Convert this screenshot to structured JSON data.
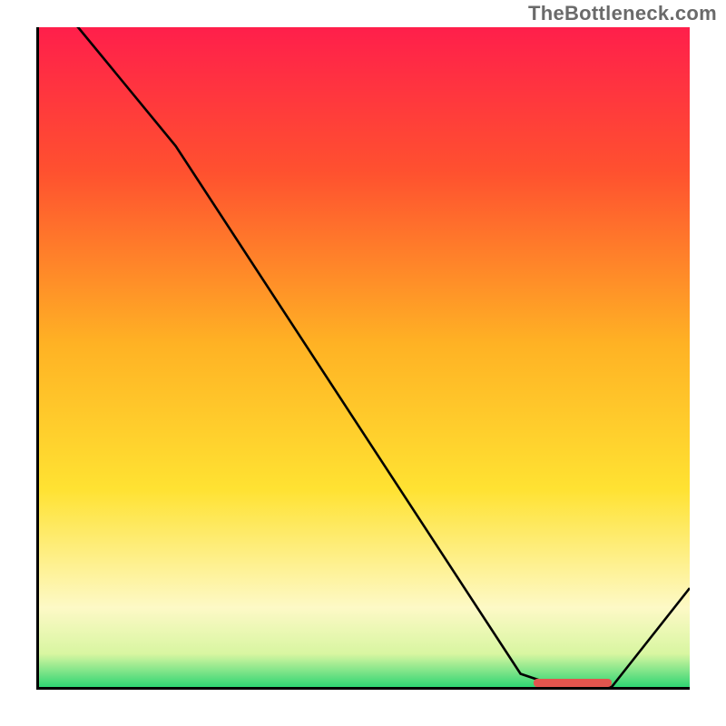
{
  "attribution": "TheBottleneck.com",
  "colors": {
    "gradient_top": "#ff1f4b",
    "gradient_upper_mid": "#ff6a2a",
    "gradient_mid": "#ffb224",
    "gradient_lower_mid": "#ffe232",
    "gradient_pale": "#fdf9c6",
    "gradient_bottom": "#2fd573",
    "curve": "#000000",
    "marker": "#e2554e",
    "axis": "#000000"
  },
  "chart_data": {
    "type": "line",
    "title": "",
    "xlabel": "",
    "ylabel": "",
    "xlim": [
      0,
      100
    ],
    "ylim": [
      0,
      100
    ],
    "gradient_stops": [
      {
        "offset": 0.0,
        "color": "#ff1f4b"
      },
      {
        "offset": 0.22,
        "color": "#ff512f"
      },
      {
        "offset": 0.48,
        "color": "#ffb224"
      },
      {
        "offset": 0.7,
        "color": "#ffe232"
      },
      {
        "offset": 0.88,
        "color": "#fdf9c6"
      },
      {
        "offset": 0.95,
        "color": "#d8f6a1"
      },
      {
        "offset": 1.0,
        "color": "#2fd573"
      }
    ],
    "series": [
      {
        "name": "bottleneck-curve",
        "x": [
          0,
          6,
          21,
          74,
          80,
          88,
          100
        ],
        "y": [
          106,
          100,
          82,
          2,
          0,
          0,
          15
        ]
      }
    ],
    "marker": {
      "name": "optimal-range",
      "x_start": 76,
      "x_end": 88,
      "y": 0
    }
  }
}
